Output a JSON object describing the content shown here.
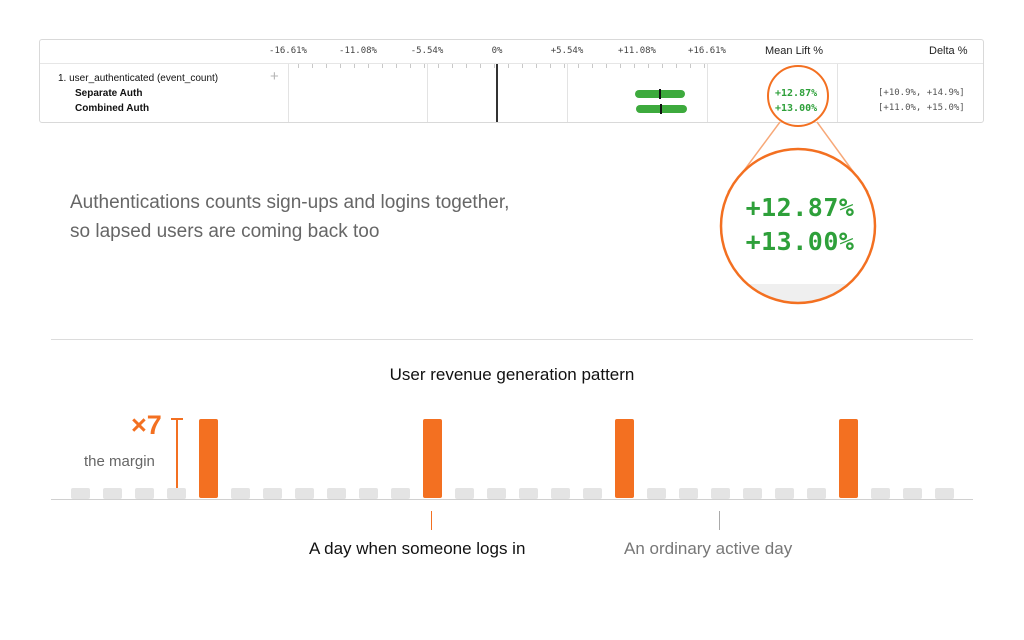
{
  "table": {
    "axis_ticks": [
      "-16.61%",
      "-11.08%",
      "-5.54%",
      "0%",
      "+5.54%",
      "+11.08%",
      "+16.61%"
    ],
    "mean_lift_header": "Mean Lift %",
    "delta_header": "Delta %",
    "metric": "1. user_authenticated (event_count)",
    "rows": [
      {
        "label": "Separate Auth",
        "lift": "+12.87%",
        "delta": "[+10.9%, +14.9%]",
        "ci_low": 10.9,
        "ci_high": 14.9,
        "mean": 12.87
      },
      {
        "label": "Combined Auth",
        "lift": "+13.00%",
        "delta": "[+11.0%, +15.0%]",
        "ci_low": 11.0,
        "ci_high": 15.0,
        "mean": 13.0
      }
    ],
    "colors": {
      "positive": "#2ea03a",
      "bar": "#3daa3d"
    }
  },
  "magnifier": {
    "values": [
      "+12.87%",
      "+13.00%"
    ],
    "color": "#f37021"
  },
  "caption": {
    "line1": "Authentications counts sign-ups and logins together,",
    "line2": "so lapsed users are coming back too"
  },
  "pattern": {
    "title": "User revenue generation pattern",
    "multiplier": "×7",
    "multiplier_caption": "the margin",
    "login_day_label": "A day when someone logs in",
    "ordinary_day_label": "An ordinary active day",
    "days": [
      0,
      0,
      0,
      0,
      1,
      0,
      0,
      0,
      0,
      0,
      0,
      1,
      0,
      0,
      0,
      0,
      0,
      1,
      0,
      0,
      0,
      0,
      0,
      0,
      1,
      0,
      0,
      0
    ],
    "colors": {
      "login": "#f37021",
      "ordinary": "#e4e4e4"
    }
  }
}
